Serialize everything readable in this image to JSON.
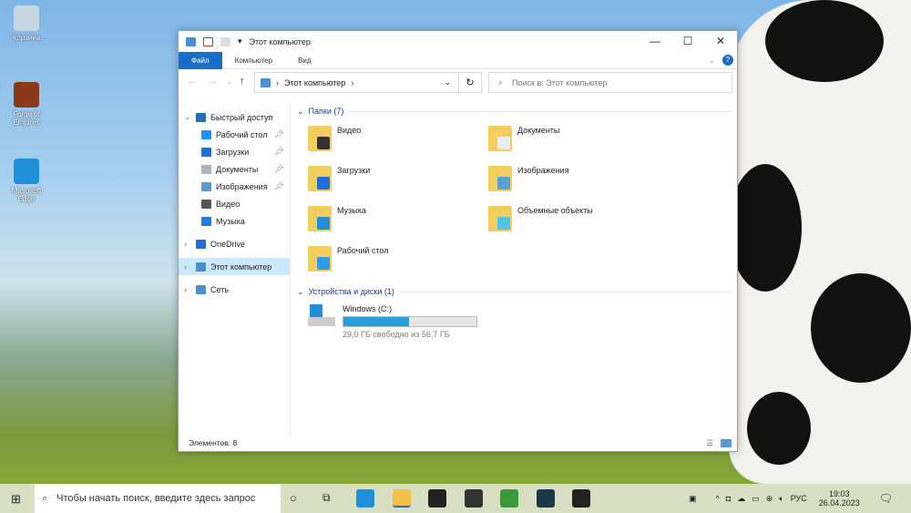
{
  "desktop": {
    "icons": [
      {
        "label": "Корзина",
        "color": "#c9d6e0"
      },
      {
        "label": "Forge of Empires",
        "color": "#8a3a1a"
      },
      {
        "label": "Microsoft Edge",
        "color": "#1e8fd8"
      }
    ]
  },
  "window": {
    "title": "Этот компьютер",
    "tabs": [
      "Файл",
      "Компьютер",
      "Вид"
    ],
    "address": "Этот компьютер",
    "search_placeholder": "Поиск в: Этот компьютер",
    "nav": [
      {
        "label": "Быстрый доступ",
        "icon": "star-icon",
        "color": "#1a6fc4",
        "level": 0,
        "expanded": true
      },
      {
        "label": "Рабочий стол",
        "icon": "desktop-icon",
        "color": "#1e90ff",
        "level": 1,
        "pinned": true
      },
      {
        "label": "Загрузки",
        "icon": "download-icon",
        "color": "#1e6fd8",
        "level": 1,
        "pinned": true
      },
      {
        "label": "Документы",
        "icon": "documents-icon",
        "color": "#aab4c0",
        "level": 1,
        "pinned": true
      },
      {
        "label": "Изображения",
        "icon": "pictures-icon",
        "color": "#5a9ad0",
        "level": 1,
        "pinned": true
      },
      {
        "label": "Видео",
        "icon": "video-icon",
        "color": "#555",
        "level": 1
      },
      {
        "label": "Музыка",
        "icon": "music-icon",
        "color": "#1e7fd8",
        "level": 1
      },
      {
        "label": "OneDrive",
        "icon": "cloud-icon",
        "color": "#1e6fd8",
        "level": 0
      },
      {
        "label": "Этот компьютер",
        "icon": "computer-icon",
        "color": "#4a8fd0",
        "level": 0,
        "selected": true
      },
      {
        "label": "Сеть",
        "icon": "network-icon",
        "color": "#4a8fd0",
        "level": 0
      }
    ],
    "folders_header": "Папки (7)",
    "folders": [
      {
        "label": "Видео",
        "accent": "#333"
      },
      {
        "label": "Документы",
        "accent": "#e8eef5"
      },
      {
        "label": "Загрузки",
        "accent": "#1e6fd8"
      },
      {
        "label": "Изображения",
        "accent": "#5aa0d8"
      },
      {
        "label": "Музыка",
        "accent": "#1e8fd8"
      },
      {
        "label": "Объемные объекты",
        "accent": "#4fc3e8"
      },
      {
        "label": "Рабочий стол",
        "accent": "#2a9fe8"
      }
    ],
    "devices_header": "Устройства и диски (1)",
    "drive": {
      "name": "Windows (C:)",
      "free": "29,0 ГБ свободно из 56,7 ГБ",
      "used_fraction": 0.49
    },
    "status": "Элементов: 8"
  },
  "taskbar": {
    "search_placeholder": "Чтобы начать поиск, введите здесь запрос",
    "apps": [
      {
        "name": "edge",
        "color": "#1e8fd8"
      },
      {
        "name": "explorer",
        "color": "#f4c04a"
      },
      {
        "name": "store",
        "color": "#222"
      },
      {
        "name": "mail",
        "color": "#333"
      },
      {
        "name": "game",
        "color": "#3a9a3a"
      },
      {
        "name": "app",
        "color": "#1a3a4a"
      },
      {
        "name": "terminal",
        "color": "#222"
      }
    ],
    "lang": "РУС",
    "time": "19:03",
    "date": "26.04.2023"
  }
}
